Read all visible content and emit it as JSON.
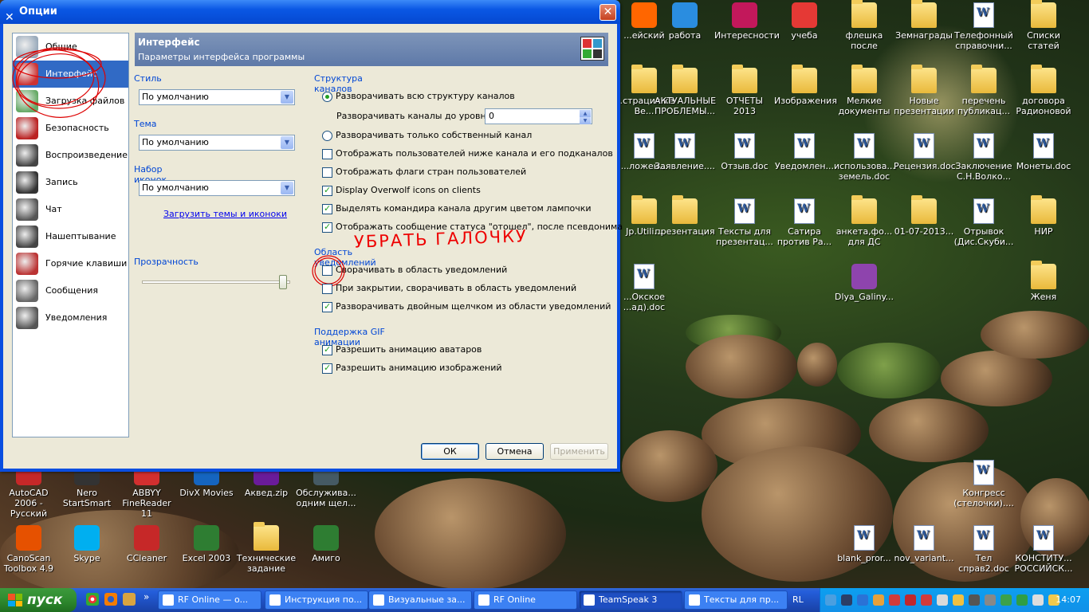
{
  "window": {
    "title": "Опции",
    "close": "✕"
  },
  "nav": [
    {
      "label": "Общие",
      "icon": "general-icon",
      "color": "#9ab"
    },
    {
      "label": "Интерфейс",
      "icon": "interface-icon",
      "color": "#c33"
    },
    {
      "label": "Загрузка файлов",
      "icon": "file-transfer-icon",
      "color": "#6a6"
    },
    {
      "label": "Безопасность",
      "icon": "security-icon",
      "color": "#b22"
    },
    {
      "label": "Воспроизведение",
      "icon": "playback-icon",
      "color": "#444"
    },
    {
      "label": "Запись",
      "icon": "microphone-icon",
      "color": "#333"
    },
    {
      "label": "Чат",
      "icon": "chat-icon",
      "color": "#555"
    },
    {
      "label": "Нашептывание",
      "icon": "whisper-icon",
      "color": "#444"
    },
    {
      "label": "Горячие клавиши",
      "icon": "hotkeys-icon",
      "color": "#b33"
    },
    {
      "label": "Сообщения",
      "icon": "messages-icon",
      "color": "#666"
    },
    {
      "label": "Уведомления",
      "icon": "notifications-icon",
      "color": "#555"
    }
  ],
  "header": {
    "title": "Интерфейс",
    "subtitle": "Параметры интерфейса программы"
  },
  "style": {
    "label": "Стиль",
    "value": "По умолчанию"
  },
  "theme": {
    "label": "Тема",
    "value": "По умолчанию"
  },
  "iconset": {
    "label": "Набор иконок",
    "value": "По умолчанию"
  },
  "load_link": "Загрузить темы и иконоки",
  "transparency": {
    "label": "Прозрачность",
    "level": 0.97
  },
  "channels": {
    "label": "Структура каналов",
    "expand_all": "Разворачивать всю структуру каналов",
    "expand_level_label": "Разворачивать каналы до уровня:",
    "expand_level_value": "0",
    "expand_own": "Разворачивать только собственный канал",
    "show_users_below": "Отображать пользователей ниже канала и его подканалов",
    "show_flags": "Отображать флаги стран пользователей",
    "overwolf": "Display Overwolf icons on clients",
    "highlight_commander": "Выделять командира канала другим цветом лампочки",
    "show_away": "Отображать сообщение статуса \"отошел\", после псевдонима"
  },
  "tray": {
    "label": "Область уведомлений",
    "minimize": "Сворачивать в область уведомлений",
    "on_close": "При закрытии, сворачивать в область уведомлений",
    "dblclick": "Разворачивать двойным щелчком из области уведомлений"
  },
  "gif": {
    "label": "Поддержка GIF анимации",
    "avatars": "Разрешить анимацию аватаров",
    "images": "Разрешить анимацию изображений"
  },
  "annotation": "УБРАТЬ ГАЛОЧКУ",
  "buttons": {
    "ok": "ОК",
    "cancel": "Отмена",
    "apply": "Применить"
  },
  "desktop_icons": [
    {
      "label": "...ейский",
      "type": "app",
      "color": "#f60"
    },
    {
      "label": "работа",
      "type": "app",
      "color": "#2a8de0"
    },
    {
      "label": "Интересности",
      "type": "app",
      "color": "#c2185b"
    },
    {
      "label": "учеба",
      "type": "app",
      "color": "#e53935"
    },
    {
      "label": "флешка после",
      "type": "folder"
    },
    {
      "label": "Земнаграды",
      "type": "folder"
    },
    {
      "label": "Телефонный справочни...",
      "type": "doc"
    },
    {
      "label": "Списки статей",
      "type": "folder"
    },
    {
      "label": "...страция ке Ве...",
      "type": "folder"
    },
    {
      "label": "АКТУАЛЬНЫЕ ПРОБЛЕМЫ...",
      "type": "folder"
    },
    {
      "label": "ОТЧЕТЫ 2013",
      "type": "folder"
    },
    {
      "label": "Изображения",
      "type": "folder"
    },
    {
      "label": "Мелкие документы",
      "type": "folder"
    },
    {
      "label": "Новые презентации",
      "type": "folder"
    },
    {
      "label": "перечень публикац...",
      "type": "folder"
    },
    {
      "label": "договора Радионовой",
      "type": "folder"
    },
    {
      "label": "...ложен...",
      "type": "doc"
    },
    {
      "label": "Заявление....",
      "type": "doc"
    },
    {
      "label": "Отзыв.doc",
      "type": "doc"
    },
    {
      "label": "Уведомлен...",
      "type": "doc"
    },
    {
      "label": "использова... земель.doc",
      "type": "doc"
    },
    {
      "label": "Рецензия.doc",
      "type": "doc"
    },
    {
      "label": "Заключение С.Н.Волко...",
      "type": "doc"
    },
    {
      "label": "Монеты.doc",
      "type": "doc"
    },
    {
      "label": "Jp.Utili...",
      "type": "folder"
    },
    {
      "label": "презентация",
      "type": "folder"
    },
    {
      "label": "Тексты для презентац...",
      "type": "doc"
    },
    {
      "label": "Сатира против Ра...",
      "type": "doc"
    },
    {
      "label": "анкета,фо... для ДС",
      "type": "folder"
    },
    {
      "label": "01-07-2013...",
      "type": "folder"
    },
    {
      "label": "Отрывок (Дис.Скуби...",
      "type": "doc"
    },
    {
      "label": "НИР",
      "type": "folder"
    },
    {
      "label": "...Окское ...ад).doc",
      "type": "doc"
    },
    {
      "label": "Dlya_Galiny...",
      "type": "app",
      "color": "#8e44ad"
    },
    {
      "label": "Женя",
      "type": "folder"
    },
    {
      "label": "Конгресс (стелочки)....",
      "type": "doc"
    },
    {
      "label": "AutoCAD 2006 - Русский",
      "type": "app",
      "color": "#c62828"
    },
    {
      "label": "Nero StartSmart",
      "type": "app",
      "color": "#333"
    },
    {
      "label": "ABBYY FineReader 11",
      "type": "app",
      "color": "#d32f2f"
    },
    {
      "label": "DivX Movies",
      "type": "app",
      "color": "#1565c0"
    },
    {
      "label": "Аквед.zip",
      "type": "app",
      "color": "#6a1b9a"
    },
    {
      "label": "Обслужива... одним щел...",
      "type": "app",
      "color": "#455a64"
    },
    {
      "label": "CanoScan Toolbox 4.9",
      "type": "app",
      "color": "#e65100"
    },
    {
      "label": "Skype",
      "type": "app",
      "color": "#00aff0"
    },
    {
      "label": "CCleaner",
      "type": "app",
      "color": "#c62828"
    },
    {
      "label": "Excel 2003",
      "type": "app",
      "color": "#2e7d32"
    },
    {
      "label": "Технические задание",
      "type": "folder"
    },
    {
      "label": "Амиго",
      "type": "app",
      "color": "#2e7d32"
    },
    {
      "label": "blank_pror...",
      "type": "doc"
    },
    {
      "label": "nov_variant...",
      "type": "doc"
    },
    {
      "label": "Тел справ2.doc",
      "type": "doc"
    },
    {
      "label": "КОНСТИТУ... РОССИЙСК...",
      "type": "doc"
    }
  ],
  "taskbar": {
    "start": "пуск",
    "quicklaunch_more": "»",
    "tasks": [
      {
        "label": "RF Online — о...",
        "icon": "chrome-icon",
        "active": false
      },
      {
        "label": "Инструкция по...",
        "icon": "word-icon",
        "active": false
      },
      {
        "label": "Визуальные за...",
        "icon": "firefox-icon",
        "active": false
      },
      {
        "label": "RF Online",
        "icon": "rf-icon",
        "active": false
      },
      {
        "label": "TeamSpeak 3",
        "icon": "teamspeak-icon",
        "active": true
      },
      {
        "label": "Тексты для пр...",
        "icon": "word-icon",
        "active": false
      }
    ],
    "lang": "RL",
    "clock": "14:07"
  }
}
